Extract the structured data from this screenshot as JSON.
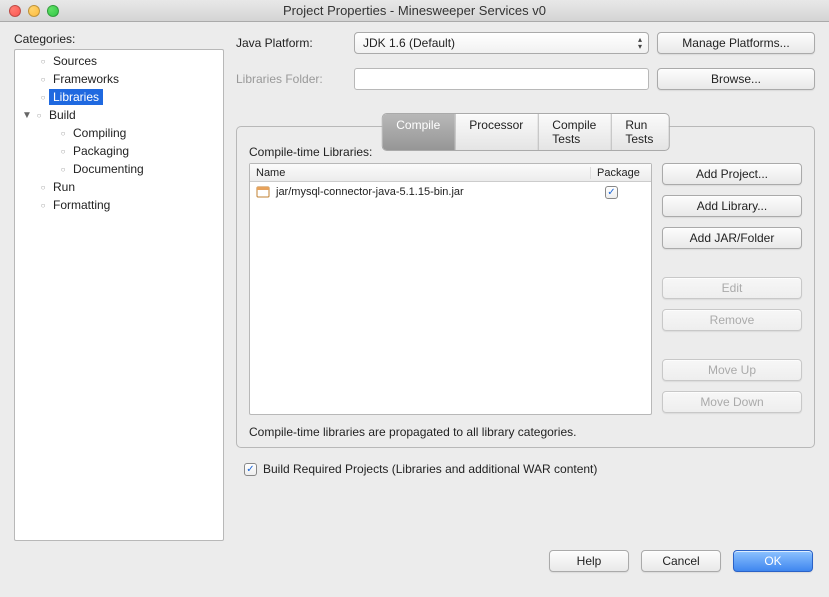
{
  "window": {
    "title": "Project Properties - Minesweeper Services v0"
  },
  "categories": {
    "heading": "Categories:",
    "items": [
      {
        "label": "Sources",
        "depth": 1
      },
      {
        "label": "Frameworks",
        "depth": 1
      },
      {
        "label": "Libraries",
        "depth": 1,
        "selected": true
      },
      {
        "label": "Build",
        "depth": 1,
        "expanded": true
      },
      {
        "label": "Compiling",
        "depth": 2
      },
      {
        "label": "Packaging",
        "depth": 2
      },
      {
        "label": "Documenting",
        "depth": 2
      },
      {
        "label": "Run",
        "depth": 1
      },
      {
        "label": "Formatting",
        "depth": 1
      }
    ]
  },
  "platform": {
    "label": "Java Platform:",
    "value": "JDK 1.6 (Default)",
    "manage_btn": "Manage Platforms..."
  },
  "libfolder": {
    "label": "Libraries Folder:",
    "value": "",
    "browse_btn": "Browse..."
  },
  "tabs": {
    "compile": "Compile",
    "processor": "Processor",
    "compile_tests": "Compile Tests",
    "run_tests": "Run Tests"
  },
  "libs": {
    "title": "Compile-time Libraries:",
    "col_name": "Name",
    "col_pkg": "Package",
    "rows": [
      {
        "name": "jar/mysql-connector-java-5.1.15-bin.jar",
        "pkg": true
      }
    ],
    "buttons": {
      "add_project": "Add Project...",
      "add_library": "Add Library...",
      "add_jar": "Add JAR/Folder",
      "edit": "Edit",
      "remove": "Remove",
      "move_up": "Move Up",
      "move_down": "Move Down"
    },
    "footnote": "Compile-time libraries are propagated to all library categories."
  },
  "build_required": {
    "checked": true,
    "label": "Build Required Projects (Libraries and additional WAR content)"
  },
  "bottom": {
    "help": "Help",
    "cancel": "Cancel",
    "ok": "OK"
  }
}
